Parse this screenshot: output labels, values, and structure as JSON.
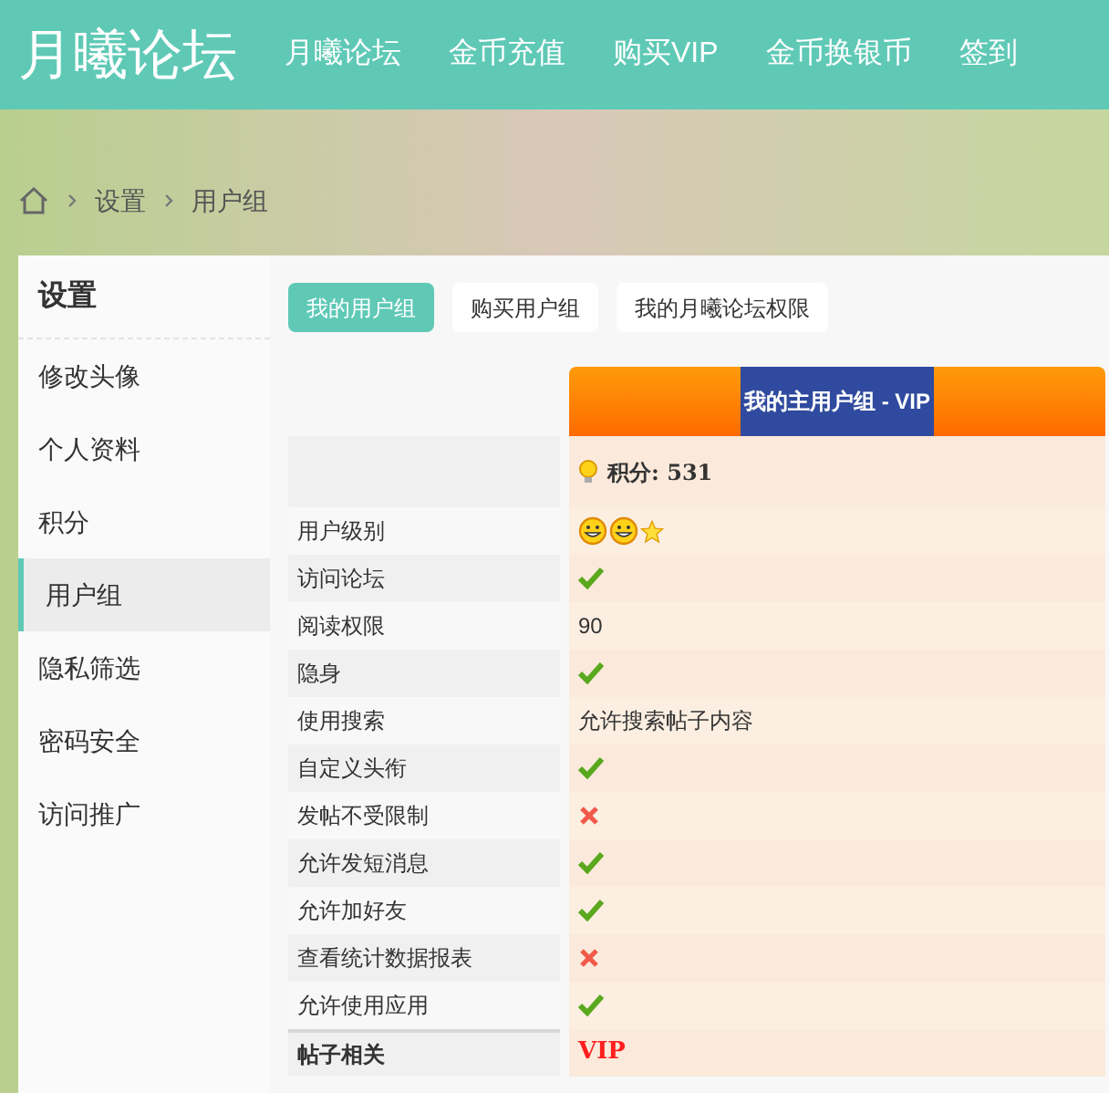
{
  "header": {
    "logo": "月曦论坛",
    "nav": [
      {
        "label": "月曦论坛"
      },
      {
        "label": "金币充值"
      },
      {
        "label": "购买VIP"
      },
      {
        "label": "金币换银币"
      },
      {
        "label": "签到"
      }
    ]
  },
  "breadcrumb": [
    "设置",
    "用户组"
  ],
  "sidebar": {
    "title": "设置",
    "items": [
      {
        "label": "修改头像",
        "selected": false
      },
      {
        "label": "个人资料",
        "selected": false
      },
      {
        "label": "积分",
        "selected": false
      },
      {
        "label": "用户组",
        "selected": true
      },
      {
        "label": "隐私筛选",
        "selected": false
      },
      {
        "label": "密码安全",
        "selected": false
      },
      {
        "label": "访问推广",
        "selected": false
      }
    ]
  },
  "tabs": [
    {
      "label": "我的用户组",
      "selected": true
    },
    {
      "label": "购买用户组",
      "selected": false
    },
    {
      "label": "我的月曦论坛权限",
      "selected": false
    }
  ],
  "group_table": {
    "heading": "我的主用户组 - VIP",
    "score": "积分: 531",
    "rows": [
      {
        "label": "用户级别",
        "kind": "level"
      },
      {
        "label": "访问论坛",
        "kind": "check",
        "allowed": true
      },
      {
        "label": "阅读权限",
        "kind": "text",
        "value": "90"
      },
      {
        "label": "隐身",
        "kind": "check",
        "allowed": true
      },
      {
        "label": "使用搜索",
        "kind": "text",
        "value": "允许搜索帖子内容"
      },
      {
        "label": "自定义头衔",
        "kind": "check",
        "allowed": true
      },
      {
        "label": "发帖不受限制",
        "kind": "check",
        "allowed": false
      },
      {
        "label": "允许发短消息",
        "kind": "check",
        "allowed": true
      },
      {
        "label": "允许加好友",
        "kind": "check",
        "allowed": true
      },
      {
        "label": "查看统计数据报表",
        "kind": "check",
        "allowed": false
      },
      {
        "label": "允许使用应用",
        "kind": "check",
        "allowed": true
      },
      {
        "label": "帖子相关",
        "kind": "section",
        "value": "VIP"
      }
    ]
  }
}
